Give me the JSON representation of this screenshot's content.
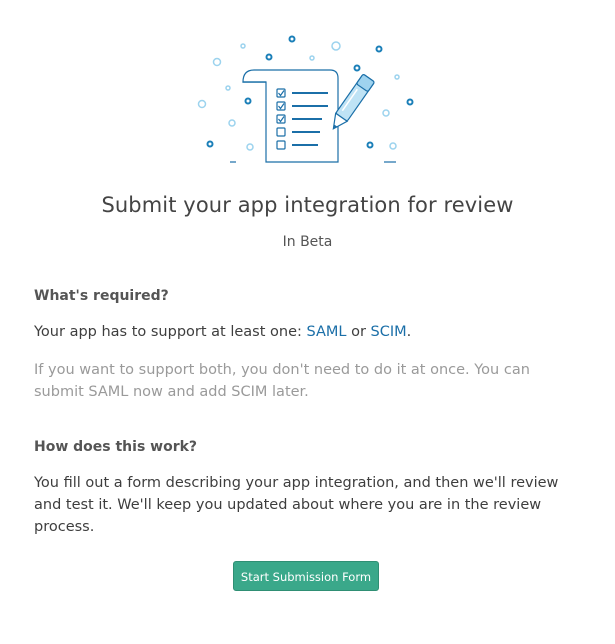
{
  "title": "Submit your app integration for review",
  "subtitle": "In Beta",
  "requirements": {
    "heading": "What's required?",
    "support_prefix": "Your app has to support at least one: ",
    "saml_link": "SAML",
    "or_text": " or ",
    "scim_link": "SCIM",
    "period": ".",
    "note": "If you want to support both, you don't need to do it at once. You can submit SAML now and add SCIM later."
  },
  "how": {
    "heading": "How does this work?",
    "body": "You fill out a form describing your app integration, and then we'll review and test it. We'll keep you updated about where you are in the review process."
  },
  "actions": {
    "start_button": "Start Submission Form"
  },
  "illustration": {
    "icon": "checklist-document-with-pen-icon",
    "colors": {
      "stroke": "#1b6fa8",
      "light_fill": "#bfe3f5",
      "dots": "#7fc4e6"
    }
  }
}
